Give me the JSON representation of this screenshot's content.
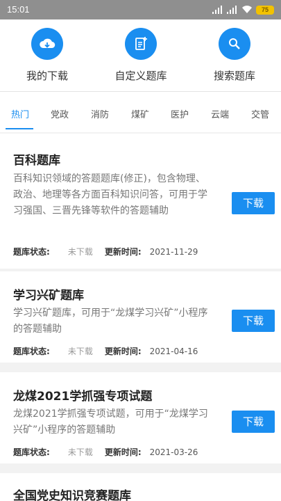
{
  "status_bar": {
    "time": "15:01",
    "battery": "75"
  },
  "quick_actions": [
    {
      "label": "我的下载",
      "icon": "cloud-download-icon"
    },
    {
      "label": "自定义题库",
      "icon": "add-document-icon"
    },
    {
      "label": "搜索题库",
      "icon": "search-icon"
    }
  ],
  "tabs": [
    {
      "label": "热门",
      "active": true
    },
    {
      "label": "党政"
    },
    {
      "label": "消防"
    },
    {
      "label": "煤矿"
    },
    {
      "label": "医护"
    },
    {
      "label": "云端"
    },
    {
      "label": "交管"
    }
  ],
  "labels": {
    "status_key": "题库状态:",
    "update_key": "更新时间:",
    "download_button": "下载"
  },
  "banks": [
    {
      "title": "百科题库",
      "description": "百科知识领域的答题题库(修正)，包含物理、政治、地理等各方面百科知识问答，可用于学习强国、三晋先锋等软件的答题辅助",
      "status": "未下载",
      "updated": "2021-11-29"
    },
    {
      "title": "学习兴矿题库",
      "description": "学习兴矿题库，可用于“龙煤学习兴矿”小程序的答题辅助",
      "status": "未下载",
      "updated": "2021-04-16"
    },
    {
      "title": "龙煤2021学抓强专项试题",
      "description": "龙煤2021学抓强专项试题，可用于“龙煤学习兴矿”小程序的答题辅助",
      "status": "未下载",
      "updated": "2021-03-26"
    },
    {
      "title": "全国党史知识竞赛题库"
    }
  ],
  "colors": {
    "accent": "#1a8ef0",
    "status_bar": "#8f8f8f",
    "list_bg": "#f2f2f2"
  }
}
